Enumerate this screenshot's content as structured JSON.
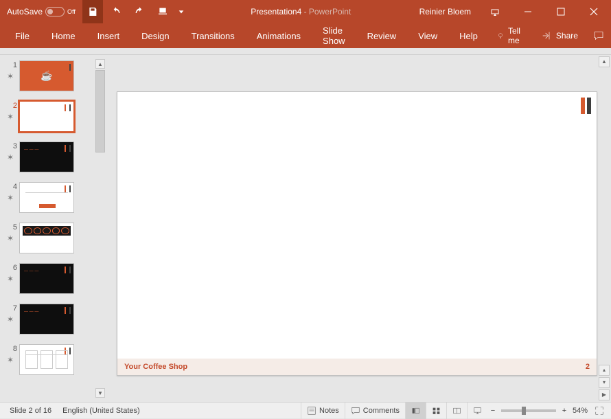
{
  "titlebar": {
    "autosave_label": "AutoSave",
    "autosave_state": "Off",
    "document_title": "Presentation4",
    "app_suffix": " - PowerPoint",
    "user": "Reinier Bloem"
  },
  "ribbon": {
    "tabs": [
      "File",
      "Home",
      "Insert",
      "Design",
      "Transitions",
      "Animations",
      "Slide Show",
      "Review",
      "View",
      "Help"
    ],
    "tellme": "Tell me",
    "share": "Share"
  },
  "thumbs": {
    "items": [
      {
        "num": "1",
        "bg": "#d65a2f",
        "text": "#fff"
      },
      {
        "num": "2",
        "bg": "#ffffff",
        "text": "#333",
        "selected": true
      },
      {
        "num": "3",
        "bg": "#0e0e0e",
        "text": "#d65a2f"
      },
      {
        "num": "4",
        "bg": "#ffffff",
        "text": "#333"
      },
      {
        "num": "5",
        "bg": "#ffffff",
        "text": "#333",
        "darktop": true
      },
      {
        "num": "6",
        "bg": "#0e0e0e",
        "text": "#d65a2f"
      },
      {
        "num": "7",
        "bg": "#0e0e0e",
        "text": "#d65a2f"
      },
      {
        "num": "8",
        "bg": "#ffffff",
        "text": "#333"
      }
    ]
  },
  "slide": {
    "footer_text": "Your Coffee Shop",
    "page_num": "2"
  },
  "statusbar": {
    "slide_label": "Slide 2 of 16",
    "language": "English (United States)",
    "notes": "Notes",
    "comments": "Comments",
    "zoom": "54%"
  }
}
